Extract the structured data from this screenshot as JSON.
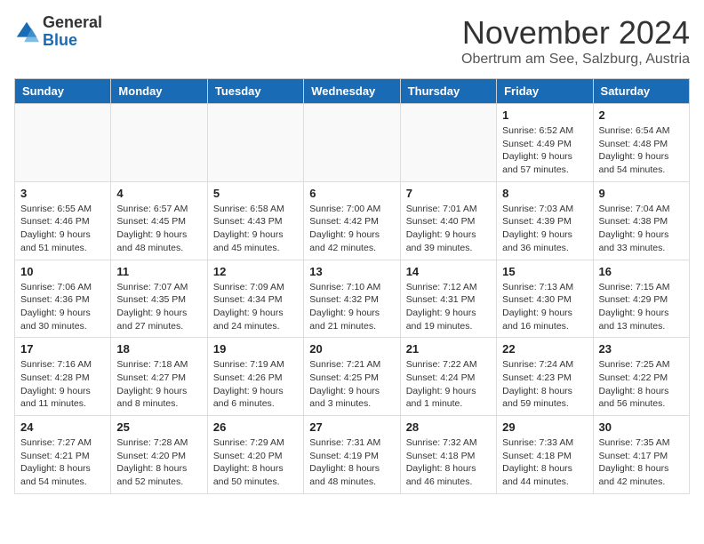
{
  "header": {
    "logo_general": "General",
    "logo_blue": "Blue",
    "month_title": "November 2024",
    "location": "Obertrum am See, Salzburg, Austria"
  },
  "weekdays": [
    "Sunday",
    "Monday",
    "Tuesday",
    "Wednesday",
    "Thursday",
    "Friday",
    "Saturday"
  ],
  "weeks": [
    [
      {
        "day": "",
        "info": ""
      },
      {
        "day": "",
        "info": ""
      },
      {
        "day": "",
        "info": ""
      },
      {
        "day": "",
        "info": ""
      },
      {
        "day": "",
        "info": ""
      },
      {
        "day": "1",
        "info": "Sunrise: 6:52 AM\nSunset: 4:49 PM\nDaylight: 9 hours\nand 57 minutes."
      },
      {
        "day": "2",
        "info": "Sunrise: 6:54 AM\nSunset: 4:48 PM\nDaylight: 9 hours\nand 54 minutes."
      }
    ],
    [
      {
        "day": "3",
        "info": "Sunrise: 6:55 AM\nSunset: 4:46 PM\nDaylight: 9 hours\nand 51 minutes."
      },
      {
        "day": "4",
        "info": "Sunrise: 6:57 AM\nSunset: 4:45 PM\nDaylight: 9 hours\nand 48 minutes."
      },
      {
        "day": "5",
        "info": "Sunrise: 6:58 AM\nSunset: 4:43 PM\nDaylight: 9 hours\nand 45 minutes."
      },
      {
        "day": "6",
        "info": "Sunrise: 7:00 AM\nSunset: 4:42 PM\nDaylight: 9 hours\nand 42 minutes."
      },
      {
        "day": "7",
        "info": "Sunrise: 7:01 AM\nSunset: 4:40 PM\nDaylight: 9 hours\nand 39 minutes."
      },
      {
        "day": "8",
        "info": "Sunrise: 7:03 AM\nSunset: 4:39 PM\nDaylight: 9 hours\nand 36 minutes."
      },
      {
        "day": "9",
        "info": "Sunrise: 7:04 AM\nSunset: 4:38 PM\nDaylight: 9 hours\nand 33 minutes."
      }
    ],
    [
      {
        "day": "10",
        "info": "Sunrise: 7:06 AM\nSunset: 4:36 PM\nDaylight: 9 hours\nand 30 minutes."
      },
      {
        "day": "11",
        "info": "Sunrise: 7:07 AM\nSunset: 4:35 PM\nDaylight: 9 hours\nand 27 minutes."
      },
      {
        "day": "12",
        "info": "Sunrise: 7:09 AM\nSunset: 4:34 PM\nDaylight: 9 hours\nand 24 minutes."
      },
      {
        "day": "13",
        "info": "Sunrise: 7:10 AM\nSunset: 4:32 PM\nDaylight: 9 hours\nand 21 minutes."
      },
      {
        "day": "14",
        "info": "Sunrise: 7:12 AM\nSunset: 4:31 PM\nDaylight: 9 hours\nand 19 minutes."
      },
      {
        "day": "15",
        "info": "Sunrise: 7:13 AM\nSunset: 4:30 PM\nDaylight: 9 hours\nand 16 minutes."
      },
      {
        "day": "16",
        "info": "Sunrise: 7:15 AM\nSunset: 4:29 PM\nDaylight: 9 hours\nand 13 minutes."
      }
    ],
    [
      {
        "day": "17",
        "info": "Sunrise: 7:16 AM\nSunset: 4:28 PM\nDaylight: 9 hours\nand 11 minutes."
      },
      {
        "day": "18",
        "info": "Sunrise: 7:18 AM\nSunset: 4:27 PM\nDaylight: 9 hours\nand 8 minutes."
      },
      {
        "day": "19",
        "info": "Sunrise: 7:19 AM\nSunset: 4:26 PM\nDaylight: 9 hours\nand 6 minutes."
      },
      {
        "day": "20",
        "info": "Sunrise: 7:21 AM\nSunset: 4:25 PM\nDaylight: 9 hours\nand 3 minutes."
      },
      {
        "day": "21",
        "info": "Sunrise: 7:22 AM\nSunset: 4:24 PM\nDaylight: 9 hours\nand 1 minute."
      },
      {
        "day": "22",
        "info": "Sunrise: 7:24 AM\nSunset: 4:23 PM\nDaylight: 8 hours\nand 59 minutes."
      },
      {
        "day": "23",
        "info": "Sunrise: 7:25 AM\nSunset: 4:22 PM\nDaylight: 8 hours\nand 56 minutes."
      }
    ],
    [
      {
        "day": "24",
        "info": "Sunrise: 7:27 AM\nSunset: 4:21 PM\nDaylight: 8 hours\nand 54 minutes."
      },
      {
        "day": "25",
        "info": "Sunrise: 7:28 AM\nSunset: 4:20 PM\nDaylight: 8 hours\nand 52 minutes."
      },
      {
        "day": "26",
        "info": "Sunrise: 7:29 AM\nSunset: 4:20 PM\nDaylight: 8 hours\nand 50 minutes."
      },
      {
        "day": "27",
        "info": "Sunrise: 7:31 AM\nSunset: 4:19 PM\nDaylight: 8 hours\nand 48 minutes."
      },
      {
        "day": "28",
        "info": "Sunrise: 7:32 AM\nSunset: 4:18 PM\nDaylight: 8 hours\nand 46 minutes."
      },
      {
        "day": "29",
        "info": "Sunrise: 7:33 AM\nSunset: 4:18 PM\nDaylight: 8 hours\nand 44 minutes."
      },
      {
        "day": "30",
        "info": "Sunrise: 7:35 AM\nSunset: 4:17 PM\nDaylight: 8 hours\nand 42 minutes."
      }
    ]
  ]
}
